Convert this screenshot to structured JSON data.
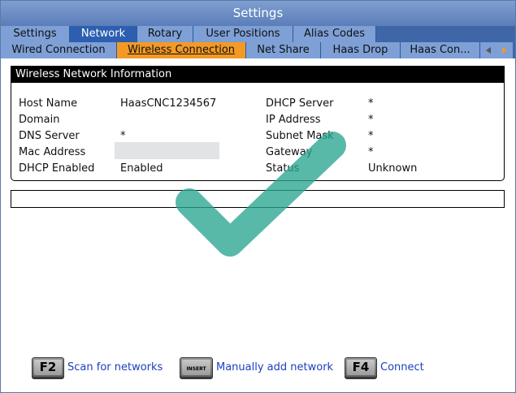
{
  "window": {
    "title": "Settings"
  },
  "tabs_primary": [
    {
      "label": "Settings"
    },
    {
      "label": "Network"
    },
    {
      "label": "Rotary"
    },
    {
      "label": "User Positions"
    },
    {
      "label": "Alias Codes"
    }
  ],
  "tabs_secondary": [
    {
      "label": "Wired Connection"
    },
    {
      "label": "Wireless Connection"
    },
    {
      "label": "Net Share"
    },
    {
      "label": "Haas Drop"
    },
    {
      "label": "Haas Con..."
    }
  ],
  "panel": {
    "title": "Wireless Network Information",
    "left": [
      {
        "label": "Host Name",
        "value": "HaasCNC1234567"
      },
      {
        "label": "Domain",
        "value": ""
      },
      {
        "label": "DNS Server",
        "value": "*"
      },
      {
        "label": "Mac Address",
        "value": ""
      },
      {
        "label": "DHCP Enabled",
        "value": "Enabled"
      }
    ],
    "right": [
      {
        "label": "DHCP Server",
        "value": "*"
      },
      {
        "label": "IP Address",
        "value": "*"
      },
      {
        "label": "Subnet Mask",
        "value": "*"
      },
      {
        "label": "Gateway",
        "value": "*"
      },
      {
        "label": "Status",
        "value": "Unknown"
      }
    ]
  },
  "overlay": {
    "icon": "checkmark-icon",
    "color": "#2aa58f"
  },
  "footer": {
    "actions": [
      {
        "key": "F2",
        "label": "Scan for networks"
      },
      {
        "key": "INSERT",
        "label": "Manually add network"
      },
      {
        "key": "F4",
        "label": "Connect"
      }
    ]
  },
  "colors": {
    "title_bar": "#5b7db9",
    "tab": "#7ea0d6",
    "active_tab_primary": "#2c5fb0",
    "active_tab_secondary": "#f39a25",
    "action_text": "#1a3fbf"
  }
}
